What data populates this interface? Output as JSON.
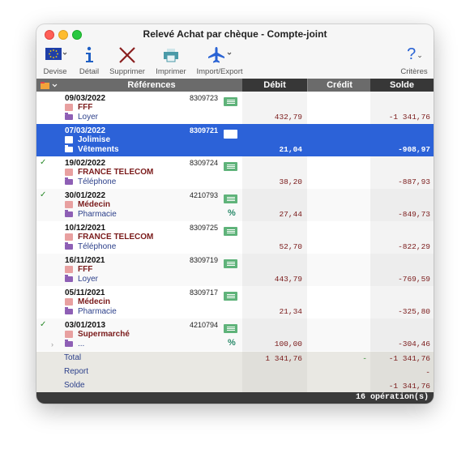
{
  "window": {
    "title": "Relevé Achat par chèque - Compte-joint"
  },
  "toolbar": {
    "devise": "Devise",
    "detail": "Détail",
    "supprimer": "Supprimer",
    "imprimer": "Imprimer",
    "import_export": "Import/Export",
    "criteres": "Critères",
    "help_glyph": "?"
  },
  "columns": {
    "references": "Références",
    "debit": "Débit",
    "credit": "Crédit",
    "solde": "Solde"
  },
  "rows": [
    {
      "check": "",
      "date": "09/03/2022",
      "number": "8309723",
      "payee": "FFF",
      "category": "Loyer",
      "memo_icon": "memo-icon",
      "pct": "",
      "debit": "432,79",
      "solde": "-1 341,76"
    },
    {
      "check": "",
      "date": "07/03/2022",
      "number": "8309721",
      "payee": "Jolimise",
      "category": "Vêtements",
      "memo_icon": "memo-icon",
      "pct": "",
      "debit": "21,04",
      "solde": "-908,97"
    },
    {
      "check": "✓",
      "date": "19/02/2022",
      "number": "8309724",
      "payee": "FRANCE TELECOM",
      "category": "Téléphone",
      "memo_icon": "memo-icon",
      "pct": "",
      "debit": "38,20",
      "solde": "-887,93"
    },
    {
      "check": "✓",
      "date": "30/01/2022",
      "number": "4210793",
      "payee": "Médecin",
      "category": "Pharmacie",
      "memo_icon": "memo-icon",
      "pct": "%",
      "debit": "27,44",
      "solde": "-849,73"
    },
    {
      "check": "",
      "date": "10/12/2021",
      "number": "8309725",
      "payee": "FRANCE TELECOM",
      "category": "Téléphone",
      "memo_icon": "memo-icon",
      "pct": "",
      "debit": "52,70",
      "solde": "-822,29"
    },
    {
      "check": "",
      "date": "16/11/2021",
      "number": "8309719",
      "payee": "FFF",
      "category": "Loyer",
      "memo_icon": "memo-icon",
      "pct": "",
      "debit": "443,79",
      "solde": "-769,59"
    },
    {
      "check": "",
      "date": "05/11/2021",
      "number": "8309717",
      "payee": "Médecin",
      "category": "Pharmacie",
      "memo_icon": "memo-icon",
      "pct": "",
      "debit": "21,34",
      "solde": "-325,80"
    },
    {
      "check": "✓",
      "date": "03/01/2013",
      "number": "4210794",
      "payee": "Supermarché",
      "category": "...",
      "memo_icon": "memo-icon",
      "pct": "%",
      "debit": "100,00",
      "solde": "-304,46"
    }
  ],
  "totals": {
    "total_label": "Total",
    "total_debit": "1 341,76",
    "total_credit": "-",
    "total_solde": "-1 341,76",
    "report_label": "Report",
    "report_solde": "-",
    "solde_label": "Solde",
    "solde_value": "-1 341,76"
  },
  "status": {
    "text": "16 opération(s)"
  },
  "colors": {
    "selection": "#2c62d8",
    "debit_text": "#7a1a1a",
    "header": "#6b6b6b"
  }
}
